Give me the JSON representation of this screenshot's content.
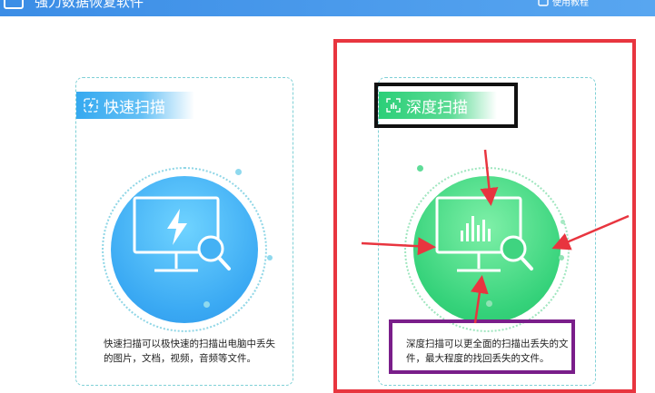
{
  "app": {
    "title": "强力数据恢复软件",
    "tutorial_label": "使用教程"
  },
  "cards": {
    "quick": {
      "title": "快速扫描",
      "description": "快速扫描可以极快速的扫描出电脑中丢失的图片，文档，视频，音频等文件。",
      "color": "#3aa9f3",
      "icon": "lightning-search-monitor-icon"
    },
    "deep": {
      "title": "深度扫描",
      "description": "深度扫描可以更全面的扫描出丢失的文件，最大程度的找回丢失的文件。",
      "color": "#35d27a",
      "icon": "bar-chart-search-monitor-icon"
    }
  },
  "annotation_colors": {
    "red": "#e8353f",
    "black": "#111111",
    "purple": "#7a1e8a"
  }
}
